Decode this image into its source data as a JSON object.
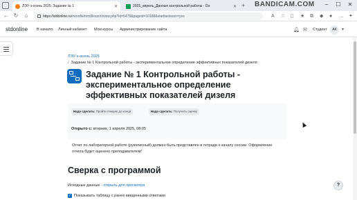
{
  "browser": {
    "tabs": [
      {
        "title": "ЛЭУ-з-осень 2025: Задание № 1",
        "active": true,
        "favicon_color": "#f98012"
      },
      {
        "title": "2025_апрель_Данные контрольной работы - Go",
        "active": false,
        "favicon_color": "#0f9d58"
      }
    ],
    "new_tab": "+",
    "watermark": "BANDICAM.COM",
    "url_host": "https://stdonline.ru",
    "url_path": "/moodle/mod/lesson/view.php?id=5478&pageid=10188&startlastseen=yes"
  },
  "navbar": {
    "brand": "stdonline",
    "menu": [
      "В начало",
      "Личный кабинет",
      "Мои курсы",
      "Администрирование сайта"
    ],
    "role": "Студент",
    "avatar_initials": "АК"
  },
  "breadcrumb": {
    "course": "ЛЭУ-з-осень 2025",
    "current": "Задание № 1 Контрольной работы - экспериментальное определение эффективных показателей дизеля"
  },
  "page": {
    "title": "Задание № 1 Контрольной работы - экспериментальное определение эффективных показателей дизеля",
    "completion": [
      {
        "label": "Надо сделать:",
        "value": "Пройти лекцию до конца"
      },
      {
        "label": "Надо сделать:",
        "value": "Получить оценку"
      }
    ],
    "opened_label": "Открыто с:",
    "opened_value": "вторник, 1 апреля 2025, 08:05",
    "description": "Отчет по лабораторной работе (рукописный) должен быть представлен в тетради к началу сессии. Оформление отчета будет оценено преподавателем!",
    "section_heading": "Сверка с программой",
    "source_label": "Исходные данные -",
    "source_link": "открыть для просмотра",
    "checkbox_label": "Показывать таблицу с ранее введенными ответами",
    "help": "?"
  }
}
